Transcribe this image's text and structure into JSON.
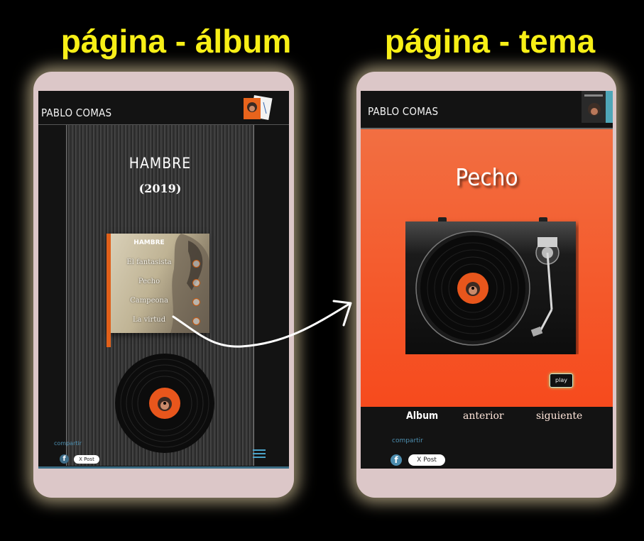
{
  "headings": {
    "album_page": "página - álbum",
    "song_page": "página - tema"
  },
  "colors": {
    "heading_yellow": "#f7ef16",
    "phone_frame": "#dcc7c8",
    "orange_bg": "#f4592b",
    "link_blue": "#4d8fb0"
  },
  "album_screen": {
    "logo": "PABLO COMAS",
    "album_title": "HAMBRE",
    "album_year": "(2019)",
    "cover": {
      "title": "HAMBRE",
      "tracks": [
        "El fantasista",
        "Pecho",
        "Campeona",
        "La virtud"
      ]
    },
    "share_label": "compartir",
    "facebook_icon": "f",
    "xpost_label": "X Post",
    "menu_icon": "hamburger-menu-icon"
  },
  "song_screen": {
    "logo": "PABLO COMAS",
    "song_title": "Pecho",
    "play_label": "play",
    "nav": {
      "album": "Album",
      "previous": "anterior",
      "next": "siguiente"
    },
    "share_label": "compartir",
    "facebook_icon": "f",
    "xpost_label": "X Post"
  }
}
